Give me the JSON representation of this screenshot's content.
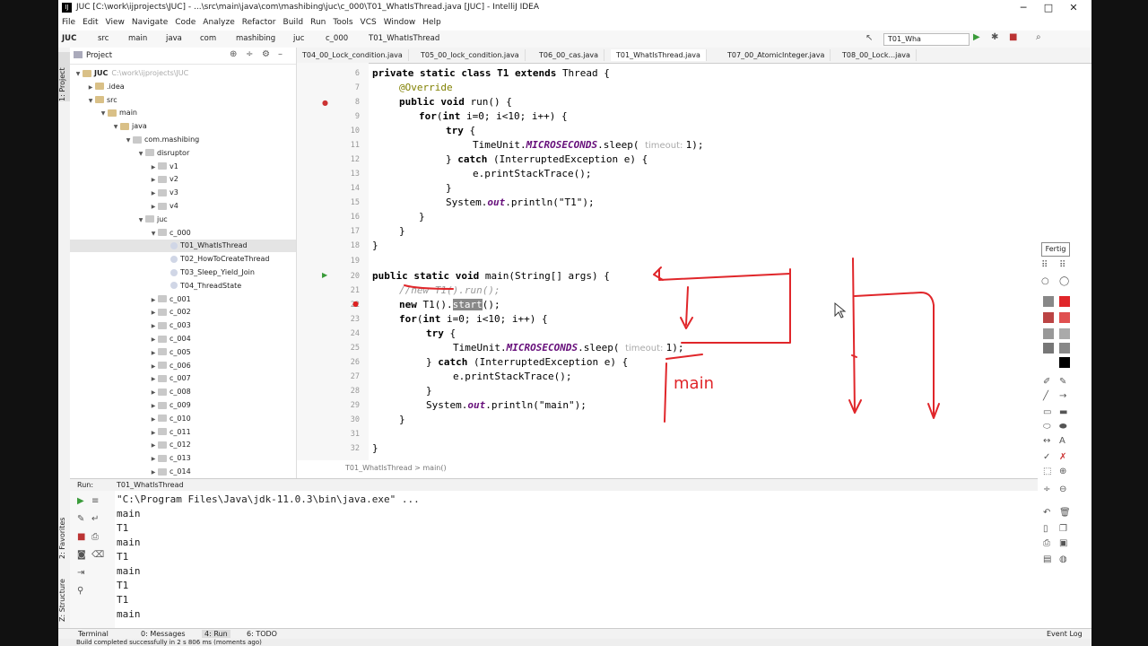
{
  "window": {
    "title": "JUC [C:\\work\\ijprojects\\JUC] - ...\\src\\main\\java\\com\\mashibing\\juc\\c_000\\T01_WhatIsThread.java [JUC] - IntelliJ IDEA",
    "minimize": "─",
    "maximize": "□",
    "close": "✕"
  },
  "menu": [
    "File",
    "Edit",
    "View",
    "Navigate",
    "Code",
    "Analyze",
    "Refactor",
    "Build",
    "Run",
    "Tools",
    "VCS",
    "Window",
    "Help"
  ],
  "breadcrumb": [
    "JUC",
    "src",
    "main",
    "java",
    "com",
    "mashibing",
    "juc",
    "c_000",
    "T01_WhatIsThread"
  ],
  "run_config": "T01_Wha",
  "tabs": [
    "T04_00_Lock_condition.java",
    "T05_00_lock_condition.java",
    "T06_00_cas.java",
    "T01_WhatIsThread.java",
    "T07_00_AtomicInteger.java",
    "T08_00_Lock...java"
  ],
  "project": {
    "header": "Project",
    "tree": [
      {
        "label": "JUC",
        "extra": "C:\\work\\ijprojects\\JUC",
        "indent": 0,
        "kind": "folder",
        "arrow": "▼"
      },
      {
        "label": ".idea",
        "indent": 1,
        "kind": "folder",
        "arrow": "▶"
      },
      {
        "label": "src",
        "indent": 1,
        "kind": "folder",
        "arrow": "▼"
      },
      {
        "label": "main",
        "indent": 2,
        "kind": "folder",
        "arrow": "▼"
      },
      {
        "label": "java",
        "indent": 3,
        "kind": "folder",
        "arrow": "▼"
      },
      {
        "label": "com.mashibing",
        "indent": 4,
        "kind": "pkg",
        "arrow": "▼"
      },
      {
        "label": "disruptor",
        "indent": 5,
        "kind": "pkg",
        "arrow": "▼"
      },
      {
        "label": "v1",
        "indent": 6,
        "kind": "pkg",
        "arrow": "▶"
      },
      {
        "label": "v2",
        "indent": 6,
        "kind": "pkg",
        "arrow": "▶"
      },
      {
        "label": "v3",
        "indent": 6,
        "kind": "pkg",
        "arrow": "▶"
      },
      {
        "label": "v4",
        "indent": 6,
        "kind": "pkg",
        "arrow": "▶"
      },
      {
        "label": "juc",
        "indent": 5,
        "kind": "pkg",
        "arrow": "▼"
      },
      {
        "label": "c_000",
        "indent": 6,
        "kind": "pkg",
        "arrow": "▼"
      },
      {
        "label": "T01_WhatIsThread",
        "indent": 7,
        "kind": "cls",
        "arrow": "",
        "selected": true
      },
      {
        "label": "T02_HowToCreateThread",
        "indent": 7,
        "kind": "cls",
        "arrow": ""
      },
      {
        "label": "T03_Sleep_Yield_Join",
        "indent": 7,
        "kind": "cls",
        "arrow": ""
      },
      {
        "label": "T04_ThreadState",
        "indent": 7,
        "kind": "cls",
        "arrow": ""
      },
      {
        "label": "c_001",
        "indent": 6,
        "kind": "pkg",
        "arrow": "▶"
      },
      {
        "label": "c_002",
        "indent": 6,
        "kind": "pkg",
        "arrow": "▶"
      },
      {
        "label": "c_003",
        "indent": 6,
        "kind": "pkg",
        "arrow": "▶"
      },
      {
        "label": "c_004",
        "indent": 6,
        "kind": "pkg",
        "arrow": "▶"
      },
      {
        "label": "c_005",
        "indent": 6,
        "kind": "pkg",
        "arrow": "▶"
      },
      {
        "label": "c_006",
        "indent": 6,
        "kind": "pkg",
        "arrow": "▶"
      },
      {
        "label": "c_007",
        "indent": 6,
        "kind": "pkg",
        "arrow": "▶"
      },
      {
        "label": "c_008",
        "indent": 6,
        "kind": "pkg",
        "arrow": "▶"
      },
      {
        "label": "c_009",
        "indent": 6,
        "kind": "pkg",
        "arrow": "▶"
      },
      {
        "label": "c_010",
        "indent": 6,
        "kind": "pkg",
        "arrow": "▶"
      },
      {
        "label": "c_011",
        "indent": 6,
        "kind": "pkg",
        "arrow": "▶"
      },
      {
        "label": "c_012",
        "indent": 6,
        "kind": "pkg",
        "arrow": "▶"
      },
      {
        "label": "c_013",
        "indent": 6,
        "kind": "pkg",
        "arrow": "▶"
      },
      {
        "label": "c_014",
        "indent": 6,
        "kind": "pkg",
        "arrow": "▶"
      }
    ]
  },
  "code": {
    "line_numbers": [
      "6",
      "7",
      "8",
      "9",
      "10",
      "11",
      "12",
      "13",
      "14",
      "15",
      "16",
      "17",
      "18",
      "19",
      "20",
      "21",
      "22",
      "23",
      "24",
      "25",
      "26",
      "27",
      "28",
      "29",
      "30",
      "31",
      "32"
    ],
    "l6_a": "private static class ",
    "l6_b": "T1 ",
    "l6_c": "extends ",
    "l6_d": "Thread {",
    "l7": "@Override",
    "l8_a": "public void ",
    "l8_b": "run() {",
    "l9_a": "for",
    "l9_b": "(",
    "l9_c": "int ",
    "l9_d": "i=0; i<10; i++) {",
    "l10_a": "try",
    "l10_b": " {",
    "l11_a": "TimeUnit.",
    "l11_b": "MICROSECONDS",
    "l11_c": ".sleep( ",
    "l11_d": "timeout: ",
    "l11_e": "1);",
    "l12_a": "} ",
    "l12_b": "catch ",
    "l12_c": "(InterruptedException e) {",
    "l13": "e.printStackTrace();",
    "l14": "}",
    "l15_a": "System.",
    "l15_b": "out",
    "l15_c": ".println(\"T1\");",
    "l16": "}",
    "l17": "}",
    "l18": "}",
    "l20_a": "public static void ",
    "l20_b": "main(String[] args) {",
    "l21": "//new T1().run();",
    "l22_a": "new ",
    "l22_b": "T1().",
    "l22_c": "start",
    "l22_d": "();",
    "l23_a": "for",
    "l23_b": "(",
    "l23_c": "int ",
    "l23_d": "i=0; i<10; i++) {",
    "l24_a": "try",
    "l24_b": " {",
    "l25_a": "TimeUnit.",
    "l25_b": "MICROSECONDS",
    "l25_c": ".sleep( ",
    "l25_d": "timeout: ",
    "l25_e": "1);",
    "l26_a": "} ",
    "l26_b": "catch ",
    "l26_c": "(InterruptedException e) {",
    "l27": "e.printStackTrace();",
    "l28": "}",
    "l29_a": "System.",
    "l29_b": "out",
    "l29_c": ".println(\"main\");",
    "l30": "}",
    "l32": "}"
  },
  "editor_breadcrumb": "T01_WhatIsThread  >  main()",
  "run": {
    "label": "Run:",
    "tab": "T01_WhatIsThread",
    "output": [
      "\"C:\\Program Files\\Java\\jdk-11.0.3\\bin\\java.exe\" ...",
      "main",
      "T1",
      "main",
      "T1",
      "main",
      "T1",
      "T1",
      "main"
    ]
  },
  "left_strip": {
    "project": "1: Project",
    "favorites": "2: Favorites",
    "structure": "Z: Structure"
  },
  "bottom": {
    "terminal": "Terminal",
    "messages": "0: Messages",
    "run": "4: Run",
    "todo": "6: TODO",
    "event_log": "Event Log"
  },
  "status": "Build completed successfully in 2 s 806 ms (moments ago)",
  "palette": {
    "done": "Fertig"
  },
  "handwriting": "main",
  "colors": {
    "ink": "#e0262a",
    "keyword": "#000080",
    "selection": "#888888"
  }
}
